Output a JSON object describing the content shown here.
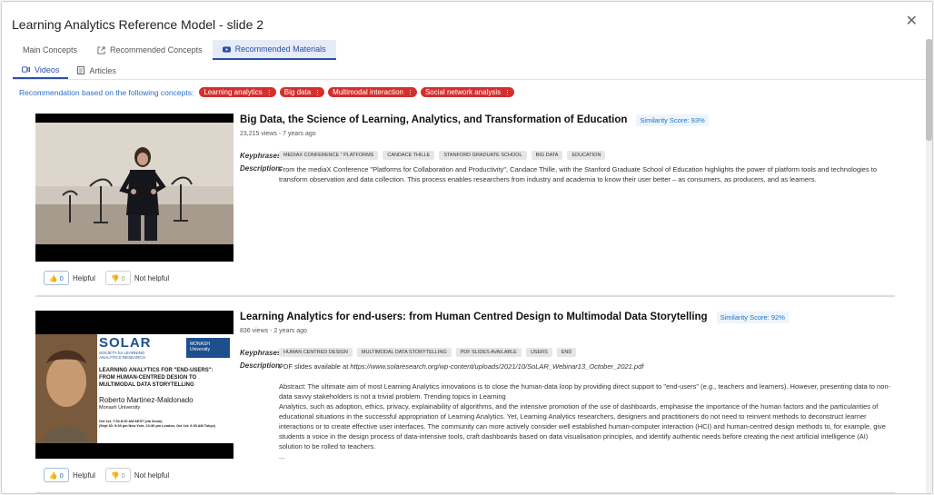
{
  "dialog": {
    "title": "Learning Analytics Reference Model - slide 2"
  },
  "tabs": [
    {
      "label": "Main Concepts"
    },
    {
      "label": "Recommended Concepts"
    },
    {
      "label": "Recommended Materials"
    }
  ],
  "subtabs": [
    {
      "label": "Videos"
    },
    {
      "label": "Articles"
    }
  ],
  "recommendation": {
    "label": "Recommendation based on the following concepts:",
    "concepts": [
      "Learning analytics",
      "Big data",
      "Multimodal interaction",
      "Social network analysis"
    ]
  },
  "items": [
    {
      "title": "Big Data, the Science of Learning, Analytics, and Transformation of Education",
      "score": "Similarity Score: 93%",
      "meta": "23,215 views - 7 years ago",
      "keyphrases_label": "Keyphrases:",
      "keyphrases": [
        "MEDIAX CONFERENCE \" PLATFORMS",
        "CANDACE THILLE",
        "STANFORD GRADUATE SCHOOL",
        "BIG DATA",
        "EDUCATION"
      ],
      "description_label": "Description:",
      "description": "From the mediaX Conference \"Platforms for Collaboration and Productivity\", Candace Thille, with the Stanford Graduate School of Education highlights the power of platform tools and technologies to transform observation and data collection. This process enables researchers from industry and academia to know their user better – as consumers, as producers, and as learners.",
      "helpful_count": "0",
      "not_helpful_count": "0",
      "helpful_label": "Helpful",
      "not_helpful_label": "Not helpful"
    },
    {
      "title": "Learning Analytics for end-users: from Human Centred Design to Multimodal Data Storytelling",
      "score": "Similarity Score: 92%",
      "meta": "836 views - 2 years ago",
      "keyphrases_label": "Keyphrases:",
      "keyphrases": [
        "HUMAN CENTRED DESIGN",
        "MULTIMODAL DATA STORYTELLING",
        "PDF SLIDES AVAILABLE",
        "USERS",
        "END"
      ],
      "description_label": "Description:",
      "description_prefix": "PDF slides available at ",
      "description_link": "https://www.solaresearch.org/wp-content/uploads/2021/10/SoLAR_Webinar13_October_2021.pdf",
      "description_p1": "Abstract: The ultimate aim of most Learning Analytics innovations is to close the human-data loop by providing direct support to \"end-users\" (e.g., teachers and learners). However, presenting data to non-data savvy stakeholders is not a trivial problem. Trending topics in Learning",
      "description_p2": "Analytics, such as adoption, ethics, privacy, explainability of algorithms, and the intensive promotion of the use of dashboards, emphasise the importance of the human factors and the particularities of educational situations in the successful appropriation of Learning Analytics. Yet, Learning Analytics researchers, designers and practitioners do not need to reinvent methods to deconstruct learner interactions or to create effective user interfaces. The community can more actively consider well established human-computer interaction (HCI) and human-centred design methods to, for example, give students a voice in the design process of data-intensive tools, craft dashboards based on data visualisation principles, and identify authentic needs before creating the next artificial intelligence (AI) solution to be rolled to teachers.",
      "description_ellipsis": "...",
      "helpful_count": "0",
      "not_helpful_count": "0",
      "helpful_label": "Helpful",
      "not_helpful_label": "Not helpful",
      "thumb": {
        "logo_sol": "SOLAR",
        "logo_sub1": "SOCIETY for LEARNING",
        "logo_sub2": "ANALYTICS RESEARCH",
        "monash": "MONASH University",
        "heading1": "LEARNING ANALYTICS FOR \"END-USERS\":",
        "heading2": "FROM HUMAN-CENTRED DESIGN TO",
        "heading3": "MULTIMODAL DATA STORYTELLING",
        "speaker": "Roberto Martinez-Maldonado",
        "affiliation": "Monash University",
        "date1": "Oct 1st, 7:30-8:30 AM AEST (via Zoom)",
        "date2": "(Sept 30: 5:30 pm New York, 10:30 pm London, Oct 1st: 6:30 AM Tokyo)"
      }
    }
  ]
}
